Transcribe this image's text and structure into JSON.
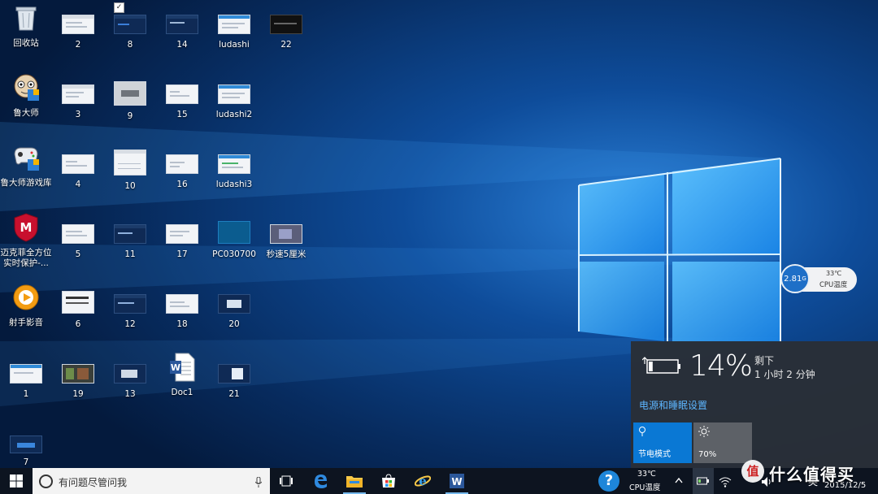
{
  "desktop": {
    "icons": [
      {
        "label": "回收站"
      },
      {
        "label": "2"
      },
      {
        "label": "8"
      },
      {
        "label": "14"
      },
      {
        "label": "ludashi"
      },
      {
        "label": "22"
      },
      {
        "label": "鲁大师"
      },
      {
        "label": "3"
      },
      {
        "label": "9"
      },
      {
        "label": "15"
      },
      {
        "label": "ludashi2"
      },
      {
        "label": "鲁大师游戏库"
      },
      {
        "label": "4"
      },
      {
        "label": "10"
      },
      {
        "label": "16"
      },
      {
        "label": "ludashi3"
      },
      {
        "label": "迈克菲全方位\n实时保护-..."
      },
      {
        "label": "5"
      },
      {
        "label": "11"
      },
      {
        "label": "17"
      },
      {
        "label": "PC030700"
      },
      {
        "label": "秒速5厘米"
      },
      {
        "label": "射手影音"
      },
      {
        "label": "6"
      },
      {
        "label": "12"
      },
      {
        "label": "18"
      },
      {
        "label": "20"
      },
      {
        "label": "1"
      },
      {
        "label": "19"
      },
      {
        "label": "13"
      },
      {
        "label": "Doc1"
      },
      {
        "label": "21"
      },
      {
        "label": "7"
      }
    ],
    "checkbox_glyph": "✓"
  },
  "cpu_widget": {
    "frequency": "2.81",
    "frequency_unit": "G",
    "temperature": "33℃",
    "temperature_label": "CPU温度"
  },
  "battery_flyout": {
    "percent": "14%",
    "remaining_label": "剩下",
    "remaining_time": "1 小时 2 分钟",
    "settings_link": "电源和睡眠设置",
    "tiles": [
      {
        "label": "节电模式",
        "icon": "battery-saver-icon"
      },
      {
        "label": "70%",
        "icon": "brightness-icon"
      }
    ],
    "brightness_level": 70,
    "battery_level": 14
  },
  "taskbar": {
    "search_placeholder": "有问题尽管问我",
    "tray_cpu_temp": "33℃",
    "tray_cpu_label": "CPU温度",
    "tray_cpu_badge": "?",
    "ime": "英",
    "date": "2015/12/5",
    "apps": [
      "task-view-icon",
      "edge-icon",
      "file-explorer-icon",
      "store-icon",
      "ie-icon",
      "word-icon"
    ]
  },
  "watermark": {
    "logo_text": "值",
    "text": "什么值得买"
  },
  "colors": {
    "accent": "#0a78d4",
    "flyout_bg": "#2a2f36",
    "link": "#5db6ff",
    "taskbar": "#0d1420"
  }
}
